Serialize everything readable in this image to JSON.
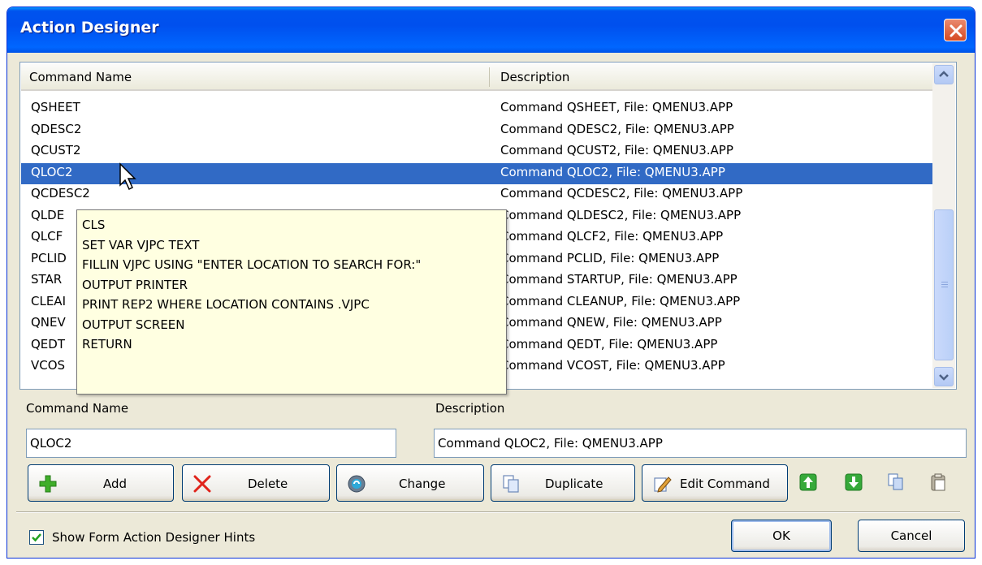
{
  "window": {
    "title": "Action Designer"
  },
  "list": {
    "columns": [
      "Command Name",
      "Description"
    ],
    "rows": [
      {
        "name": "QSHEET",
        "desc": "Command QSHEET, File: QMENU3.APP"
      },
      {
        "name": "QDESC2",
        "desc": "Command QDESC2, File: QMENU3.APP"
      },
      {
        "name": "QCUST2",
        "desc": "Command QCUST2, File: QMENU3.APP"
      },
      {
        "name": "QLOC2",
        "desc": "Command QLOC2, File: QMENU3.APP"
      },
      {
        "name": "QCDESC2",
        "desc": "Command QCDESC2, File: QMENU3.APP"
      },
      {
        "name": "QLDE",
        "desc": "Command QLDESC2, File: QMENU3.APP"
      },
      {
        "name": "QLCF",
        "desc": "Command QLCF2, File: QMENU3.APP"
      },
      {
        "name": "PCLID",
        "desc": "Command PCLID, File: QMENU3.APP"
      },
      {
        "name": "STAR",
        "desc": "Command STARTUP, File: QMENU3.APP"
      },
      {
        "name": "CLEAI",
        "desc": "Command CLEANUP, File: QMENU3.APP"
      },
      {
        "name": "QNEV",
        "desc": "Command QNEW, File: QMENU3.APP"
      },
      {
        "name": "QEDT",
        "desc": "Command QEDT, File: QMENU3.APP"
      },
      {
        "name": "VCOS",
        "desc": "Command VCOST, File: QMENU3.APP"
      }
    ]
  },
  "tooltip": {
    "lines": [
      "CLS",
      "SET VAR VJPC TEXT",
      "FILLIN VJPC USING \"ENTER LOCATION TO SEARCH FOR:\"",
      "OUTPUT PRINTER",
      "PRINT REP2 WHERE LOCATION CONTAINS .VJPC",
      "OUTPUT SCREEN",
      "RETURN"
    ]
  },
  "form": {
    "command_name_label": "Command Name",
    "description_label": "Description",
    "command_name_value": "QLOC2",
    "description_value": "Command QLOC2, File: QMENU3.APP"
  },
  "toolbar": {
    "add": "Add",
    "delete": "Delete",
    "change": "Change",
    "duplicate": "Duplicate",
    "edit_command": "Edit Command"
  },
  "footer": {
    "hints_label": "Show Form Action Designer Hints",
    "ok": "OK",
    "cancel": "Cancel"
  },
  "colors": {
    "title_bar": "#0053ee",
    "selection": "#316ac5",
    "tooltip_bg": "#ffffe1",
    "dialog_bg": "#ece9d8"
  }
}
